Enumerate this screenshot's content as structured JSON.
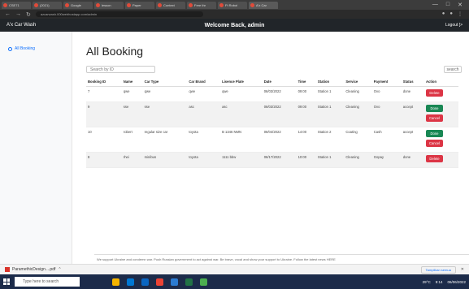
{
  "browser": {
    "tabs": [
      "CSE71",
      "(2021)",
      "Google",
      "lesson",
      "Paper",
      "Context",
      "Free thr",
      "Ft Robot",
      "A'x Car"
    ],
    "url": "azcarwash.000webhostapp.com/admin"
  },
  "navbar": {
    "brand": "A'x Car Wash",
    "welcome": "Welcome Back, admin",
    "logout": "Logout [>"
  },
  "sidebar": {
    "items": [
      {
        "label": "All Booking"
      }
    ]
  },
  "page": {
    "title": "All Booking"
  },
  "search": {
    "placeholder": "Search by ID",
    "button": "search"
  },
  "table": {
    "headers": [
      "Booking ID",
      "Name",
      "Car Type",
      "Car Brand",
      "Lisence Plate",
      "Date",
      "Time",
      "Station",
      "Service",
      "Payment",
      "Status",
      "Action"
    ],
    "rows": [
      {
        "cells": [
          "7",
          "qwe",
          "qwe",
          "qwe",
          "qwe",
          "06/03/2022",
          "09:00",
          "Station 1",
          "Cleaning",
          "Ovo",
          "done"
        ],
        "actions": [
          "Delete"
        ]
      },
      {
        "cells": [
          "9",
          "sse",
          "sse",
          "asc",
          "asc",
          "06/03/2022",
          "09:00",
          "Station 1",
          "Cleaning",
          "Ovo",
          "accept"
        ],
        "actions": [
          "Done",
          "Cancel"
        ]
      },
      {
        "cells": [
          "10",
          "robert",
          "regular size car",
          "toyota",
          "B 1346 NMN",
          "06/04/2022",
          "14:00",
          "Station 2",
          "Coating",
          "Cash",
          "accept"
        ],
        "actions": [
          "Done",
          "Cancel"
        ]
      },
      {
        "cells": [
          "8",
          "rhei",
          "minibus",
          "toyota",
          "1111 bbw",
          "06/17/2022",
          "10:00",
          "Station 1",
          "Cleaning",
          "Gopay",
          "done"
        ],
        "actions": [
          "Delete"
        ]
      }
    ]
  },
  "notice": {
    "text": "We support Ukraine and condemn war. Push Russian government to act against war. Be brave, vocal and show your support to Ukraine. Follow the latest news HERE"
  },
  "downloads": {
    "file": "ParamethicDesign....pdf",
    "show_all": "Tampilkan semua"
  },
  "taskbar": {
    "search_placeholder": "Type here to search",
    "weather": "29°C",
    "time": "9:14",
    "date": "06/06/2022"
  },
  "colors": {
    "navbar": "#212529",
    "danger": "#dc3545",
    "success": "#198754",
    "link": "#0d6efd"
  }
}
